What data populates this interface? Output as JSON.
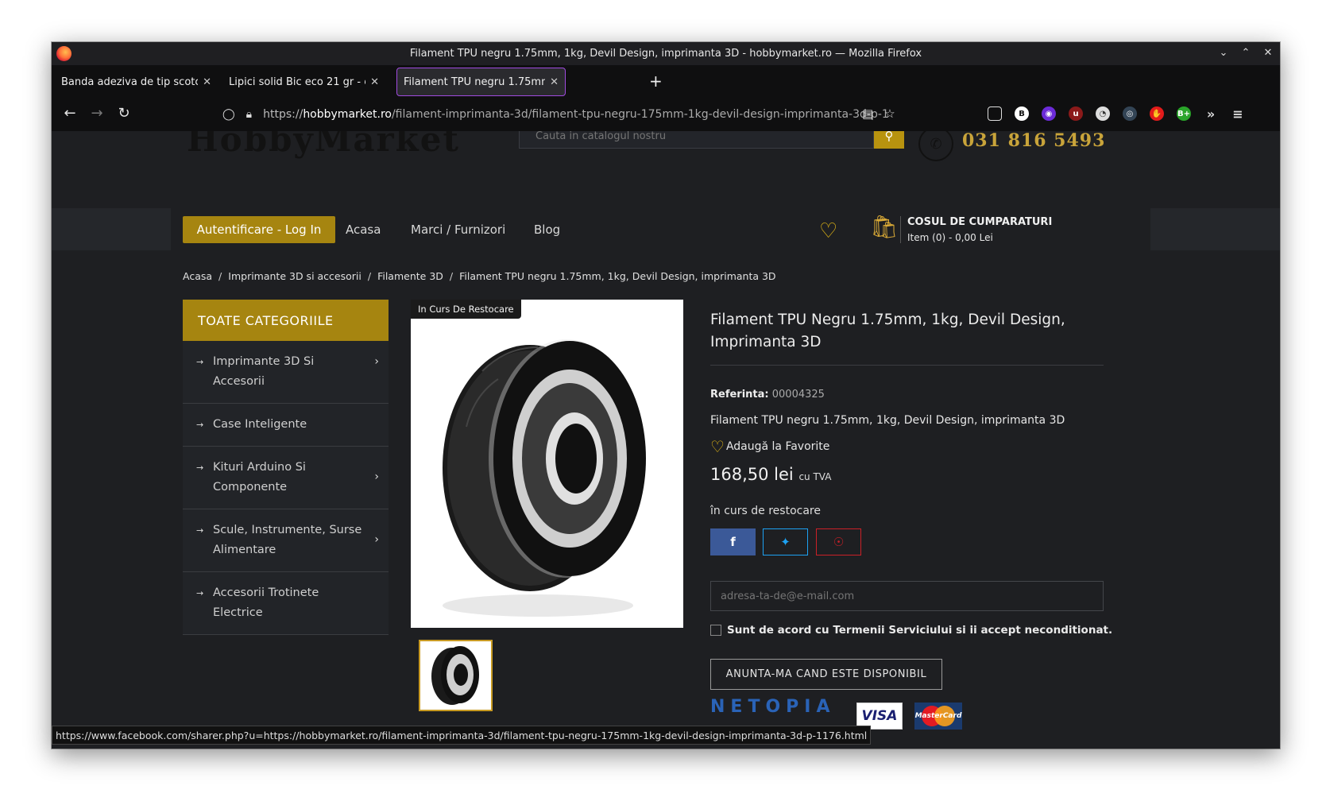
{
  "window": {
    "title": "Filament TPU negru 1.75mm, 1kg, Devil Design, imprimanta 3D - hobbymarket.ro — Mozilla Firefox"
  },
  "tabs": [
    {
      "label": "Banda adeziva de tip scotch",
      "favicon": "e"
    },
    {
      "label": "Lipici solid Bic eco 21 gr - e",
      "favicon": "e"
    },
    {
      "label": "Filament TPU negru 1.75mm",
      "favicon": "page"
    }
  ],
  "url": {
    "scheme": "https://",
    "host": "hobbymarket.ro",
    "path": "/filament-imprimanta-3d/filament-tpu-negru-175mm-1kg-devil-design-imprimanta-3d-p-1"
  },
  "header": {
    "logo": "HobbyMarket",
    "search_placeholder": "Cauta in catalogul nostru",
    "phone": "031 816 5493"
  },
  "menu": {
    "login": "Autentificare - Log In",
    "items": [
      "Acasa",
      "Marci / Furnizori",
      "Blog"
    ],
    "cart_title": "COSUL DE CUMPARATURI",
    "cart_sub": "Item (0) - 0,00 Lei"
  },
  "breadcrumb": [
    "Acasa",
    "Imprimante 3D si accesorii",
    "Filamente 3D",
    "Filament TPU negru 1.75mm, 1kg, Devil Design, imprimanta 3D"
  ],
  "categories": {
    "heading": "TOATE CATEGORIILE",
    "items": [
      {
        "label": "Imprimante 3D Si Accesorii"
      },
      {
        "label": "Case Inteligente"
      },
      {
        "label": "Kituri Arduino Si Componente"
      },
      {
        "label": "Scule, Instrumente, Surse Alimentare"
      },
      {
        "label": "Accesorii Trotinete Electrice"
      }
    ]
  },
  "product": {
    "badge": "In Curs De Restocare",
    "title": "Filament TPU Negru 1.75mm, 1kg, Devil Design, Imprimanta 3D",
    "ref_label": "Referinta:",
    "ref_value": "00004325",
    "short_desc": "Filament TPU negru 1.75mm, 1kg, Devil Design, imprimanta 3D",
    "favorite": "Adaugă la Favorite",
    "price": "168,50 lei",
    "price_tax": "cu TVA",
    "stock": "în curs de restocare",
    "email_placeholder": "adresa-ta-de@e-mail.com",
    "agree": "Sunt de acord cu Termenii Serviciului si ii accept neconditionat.",
    "notify": "ANUNTA-MA CAND ESTE DISPONIBIL",
    "payment_brand": "NETOPIA",
    "visa": "VISA",
    "mastercard": "MasterCard"
  },
  "status_url": "https://www.facebook.com/sharer.php?u=https://hobbymarket.ro/filament-imprimanta-3d/filament-tpu-negru-175mm-1kg-devil-design-imprimanta-3d-p-1176.html",
  "colors": {
    "accent": "#a68510",
    "page_bg": "#1e1f22",
    "phone": "#c9a43a",
    "facebook": "#3b5998",
    "twitter": "#1da1f2",
    "pinterest": "#cb2027"
  }
}
